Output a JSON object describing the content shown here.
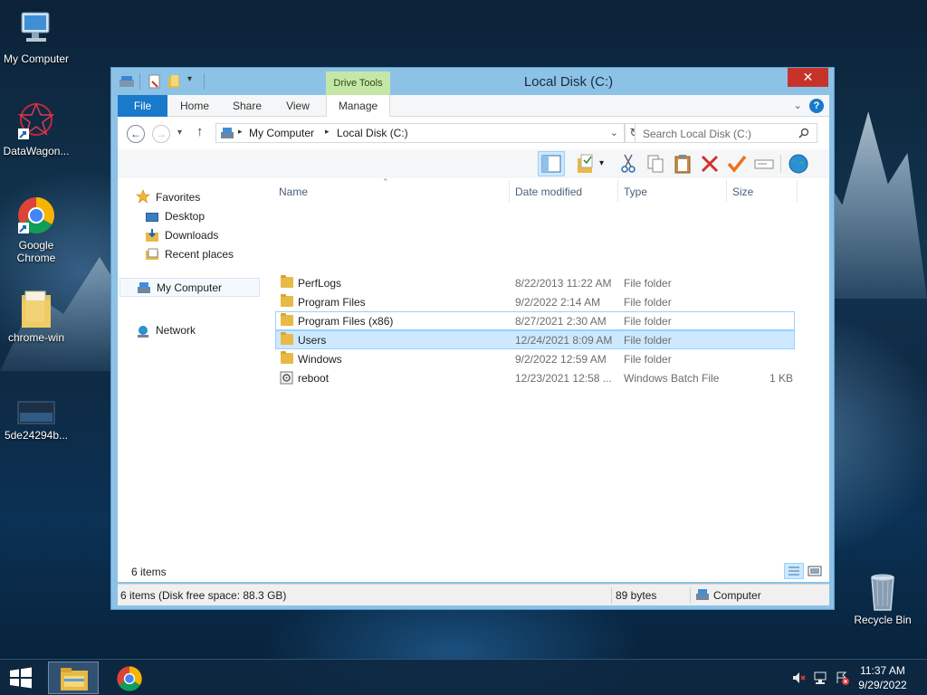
{
  "desktop": {
    "icons": [
      {
        "label": "My Computer"
      },
      {
        "label": "DataWagon..."
      },
      {
        "label": "Google Chrome"
      },
      {
        "label": "chrome-win"
      },
      {
        "label": "5de24294b..."
      },
      {
        "label": "Recycle Bin"
      }
    ]
  },
  "window": {
    "title": "Local Disk (C:)",
    "close_glyph": "✕",
    "contextual_tab_group": "Drive Tools",
    "ribbon_tabs": [
      "File",
      "Home",
      "Share",
      "View",
      "Manage"
    ],
    "help_glyph": "?",
    "address": {
      "breadcrumb": [
        "My Computer",
        "Local Disk (C:)"
      ],
      "separator": "▸"
    },
    "search": {
      "placeholder": "Search Local Disk (C:)"
    },
    "nav_pane": {
      "favorites_label": "Favorites",
      "favorites": [
        "Desktop",
        "Downloads",
        "Recent places"
      ],
      "my_computer": "My Computer",
      "network": "Network"
    },
    "columns": [
      "Name",
      "Date modified",
      "Type",
      "Size"
    ],
    "files": [
      {
        "name": "PerfLogs",
        "date": "8/22/2013 11:22 AM",
        "type": "File folder",
        "size": "",
        "icon": "folder-icon"
      },
      {
        "name": "Program Files",
        "date": "9/2/2022 2:14 AM",
        "type": "File folder",
        "size": "",
        "icon": "folder-icon"
      },
      {
        "name": "Program Files (x86)",
        "date": "8/27/2021 2:30 AM",
        "type": "File folder",
        "size": "",
        "icon": "folder-icon"
      },
      {
        "name": "Users",
        "date": "12/24/2021 8:09 AM",
        "type": "File folder",
        "size": "",
        "icon": "folder-icon"
      },
      {
        "name": "Windows",
        "date": "9/2/2022 12:59 AM",
        "type": "File folder",
        "size": "",
        "icon": "folder-icon"
      },
      {
        "name": "reboot",
        "date": "12/23/2021 12:58 ...",
        "type": "Windows Batch File",
        "size": "1 KB",
        "icon": "batch-file-icon"
      }
    ],
    "item_count": "6 items",
    "status": {
      "left": "6 items (Disk free space: 88.3 GB)",
      "size": "89 bytes",
      "location": "Computer"
    }
  },
  "taskbar": {
    "time": "11:37 AM",
    "date": "9/29/2022"
  },
  "colors": {
    "accent": "#1979ca",
    "selection": "#cde8ff",
    "selection_border": "#99d1ff",
    "close": "#c7332b",
    "drive_tools": "#c5e7a6"
  }
}
